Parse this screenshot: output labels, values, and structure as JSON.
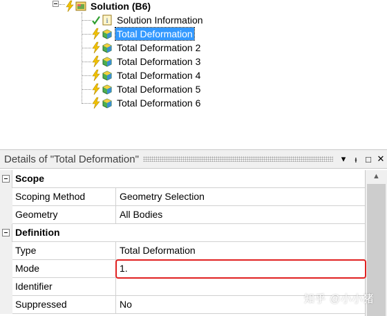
{
  "tree": {
    "root": {
      "label": "Solution (B6)",
      "icon": "solution-icon"
    },
    "items": [
      {
        "label": "Solution Information",
        "status": "check",
        "icon": "info-icon",
        "selected": false
      },
      {
        "label": "Total Deformation",
        "status": "lightning",
        "icon": "deformation-icon",
        "selected": true
      },
      {
        "label": "Total Deformation 2",
        "status": "lightning",
        "icon": "deformation-icon",
        "selected": false
      },
      {
        "label": "Total Deformation 3",
        "status": "lightning",
        "icon": "deformation-icon",
        "selected": false
      },
      {
        "label": "Total Deformation 4",
        "status": "lightning",
        "icon": "deformation-icon",
        "selected": false
      },
      {
        "label": "Total Deformation 5",
        "status": "lightning",
        "icon": "deformation-icon",
        "selected": false
      },
      {
        "label": "Total Deformation 6",
        "status": "lightning",
        "icon": "deformation-icon",
        "selected": false
      }
    ]
  },
  "details": {
    "title": "Details of \"Total Deformation\"",
    "controls": {
      "dropdown": "▾",
      "pin": "ᵻ",
      "maximize": "□",
      "close": "✕"
    },
    "groups": [
      {
        "name": "Scope",
        "props": [
          {
            "name": "Scoping Method",
            "value": "Geometry Selection"
          },
          {
            "name": "Geometry",
            "value": "All Bodies"
          }
        ]
      },
      {
        "name": "Definition",
        "props": [
          {
            "name": "Type",
            "value": "Total Deformation"
          },
          {
            "name": "Mode",
            "value": "1."
          },
          {
            "name": "Identifier",
            "value": ""
          },
          {
            "name": "Suppressed",
            "value": "No"
          }
        ]
      }
    ]
  },
  "watermark": "知乎 @小小猪",
  "colors": {
    "selection": "#3399ff",
    "highlight_border": "#e02020",
    "panel_bg": "#f0f0f0"
  }
}
